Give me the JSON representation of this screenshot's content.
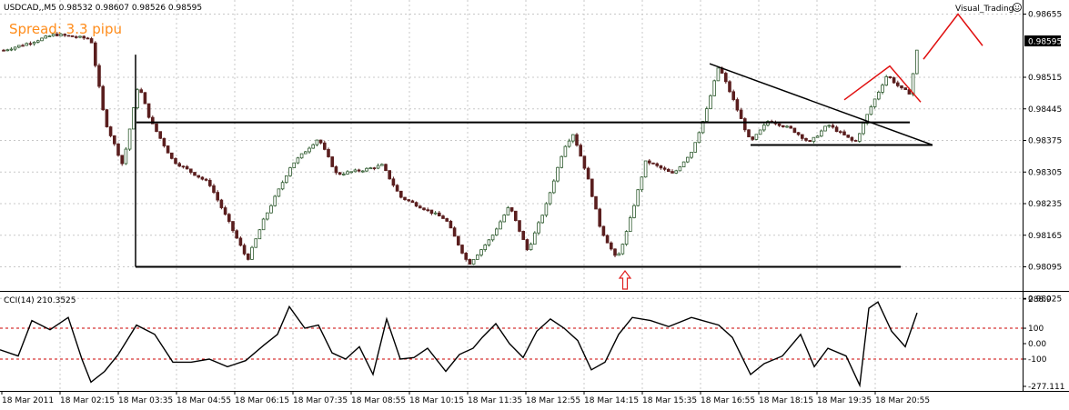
{
  "window": {
    "symbol_header": "USDCAD,,M5  0.98532 0.98607 0.98526 0.98595",
    "spread_text": "Spread: 3.3 pipu",
    "watermark": "Visual_Trading",
    "watermark_icon": "smiley-icon"
  },
  "price_panel": {
    "current_price": "0.98595",
    "price_labels": [
      "0.98655",
      "0.98515",
      "0.98445",
      "0.98375",
      "0.98305",
      "0.98235",
      "0.98165",
      "0.98095",
      "0.98025"
    ],
    "arrow_icon": "up-arrow-icon"
  },
  "indicator_panel": {
    "header": "CCI(14) 210.3525",
    "labels": [
      "288.9",
      "100",
      "0.00",
      "-100",
      "-277.111"
    ]
  },
  "time_axis": {
    "labels": [
      "18 Mar 2011",
      "18 Mar 02:15",
      "18 Mar 03:35",
      "18 Mar 04:55",
      "18 Mar 06:15",
      "18 Mar 07:35",
      "18 Mar 08:55",
      "18 Mar 10:15",
      "18 Mar 11:35",
      "18 Mar 12:55",
      "18 Mar 14:15",
      "18 Mar 15:35",
      "18 Mar 16:55",
      "18 Mar 18:15",
      "18 Mar 19:35",
      "18 Mar 20:55"
    ]
  },
  "colors": {
    "grid": "#c8c8c8",
    "bull_candle": "#2e5a2e",
    "bear_candle": "#5a1e1e",
    "price_highlight_bg": "#000000",
    "price_highlight_fg": "#ffffff",
    "spread": "#ff8c1a",
    "pattern_line": "#e01010",
    "cci_level": "#cc0000",
    "arrow": "#e02020"
  },
  "chart_data": {
    "type": "candlestick",
    "ylim": [
      0.98025,
      0.98655
    ],
    "pattern_lines": {
      "support_low": 0.98095,
      "resistance": 0.98415,
      "triangle_low": 0.98365
    },
    "cci": {
      "range": [
        -277.111,
        288.9
      ],
      "levels": [
        100,
        0,
        -100
      ],
      "last": 210.3525
    }
  }
}
